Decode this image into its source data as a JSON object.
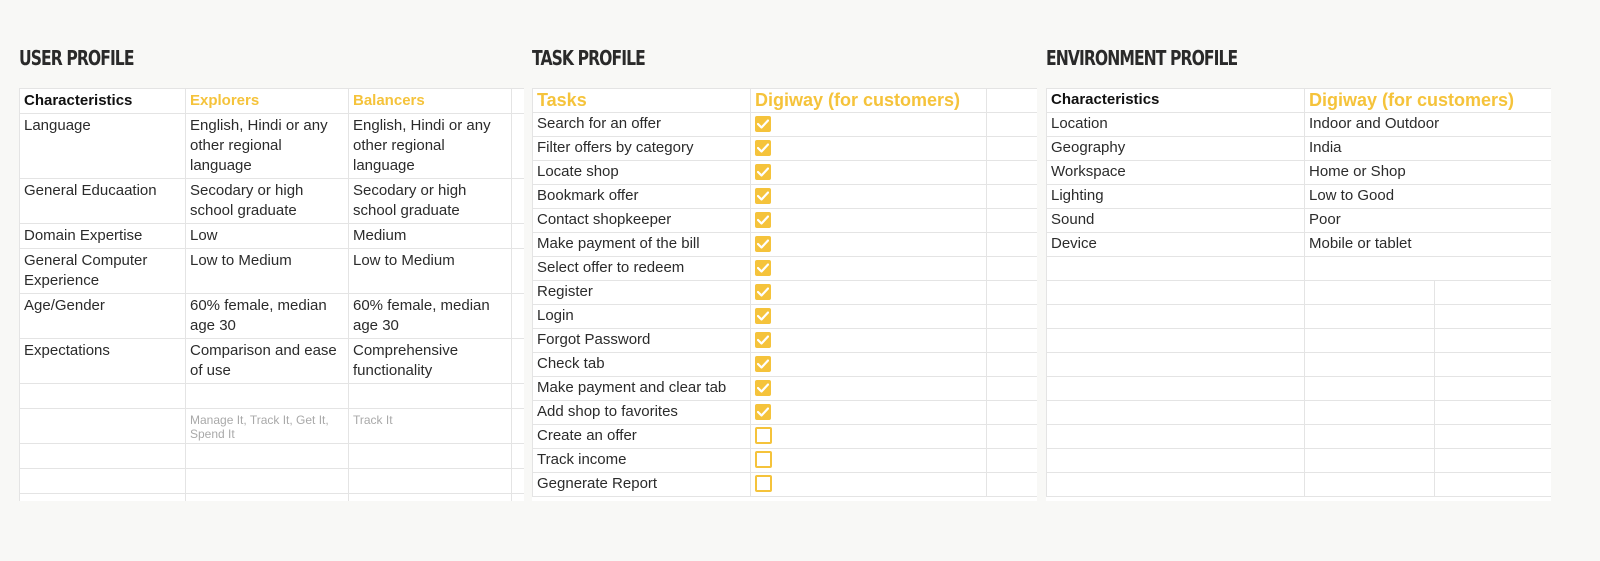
{
  "user_profile": {
    "title": "USER PROFILE",
    "headers": [
      "Characteristics",
      "Explorers",
      "Balancers"
    ],
    "rows": [
      [
        "Language",
        "English, Hindi or any other regional language",
        "English, Hindi or any other regional language"
      ],
      [
        "General Educaation",
        "Secodary or high school graduate",
        "Secodary or high school graduate"
      ],
      [
        "Domain Expertise",
        "Low",
        "Medium"
      ],
      [
        "General Computer Experience",
        "Low to Medium",
        "Low to Medium"
      ],
      [
        "Age/Gender",
        "60% female, median age 30",
        "60% female, median age 30"
      ],
      [
        "Expectations",
        "Comparison and ease of use",
        "Comprehensive functionality"
      ]
    ],
    "notes": [
      "Manage It, Track It, Get It, Spend It",
      "Track It"
    ]
  },
  "task_profile": {
    "title": "TASK PROFILE",
    "headers": [
      "Tasks",
      "Digiway (for customers)"
    ],
    "tasks": [
      {
        "label": "Search for an offer",
        "checked": true
      },
      {
        "label": "Filter offers by category",
        "checked": true
      },
      {
        "label": "Locate shop",
        "checked": true
      },
      {
        "label": "Bookmark offer",
        "checked": true
      },
      {
        "label": "Contact shopkeeper",
        "checked": true
      },
      {
        "label": "Make payment of the bill",
        "checked": true
      },
      {
        "label": "Select offer to redeem",
        "checked": true
      },
      {
        "label": "Register",
        "checked": true
      },
      {
        "label": "Login",
        "checked": true
      },
      {
        "label": "Forgot Password",
        "checked": true
      },
      {
        "label": "Check tab",
        "checked": true
      },
      {
        "label": "Make payment and clear tab",
        "checked": true
      },
      {
        "label": "Add shop to favorites",
        "checked": true
      },
      {
        "label": "Create an offer",
        "checked": false
      },
      {
        "label": "Track income",
        "checked": false
      },
      {
        "label": "Gegnerate Report",
        "checked": false
      }
    ]
  },
  "environment_profile": {
    "title": "ENVIRONMENT PROFILE",
    "headers": [
      "Characteristics",
      "Digiway (for customers)"
    ],
    "rows": [
      [
        "Location",
        "Indoor and Outdoor"
      ],
      [
        "Geography",
        "India"
      ],
      [
        "Workspace",
        "Home or Shop"
      ],
      [
        "Lighting",
        "Low to Good"
      ],
      [
        "Sound",
        "Poor"
      ],
      [
        "Device",
        "Mobile or tablet"
      ]
    ]
  },
  "colors": {
    "accent": "#f5c33b",
    "background": "#f8f8f6",
    "grid": "#e4e4e4",
    "muted_text": "#a9a9a9"
  }
}
